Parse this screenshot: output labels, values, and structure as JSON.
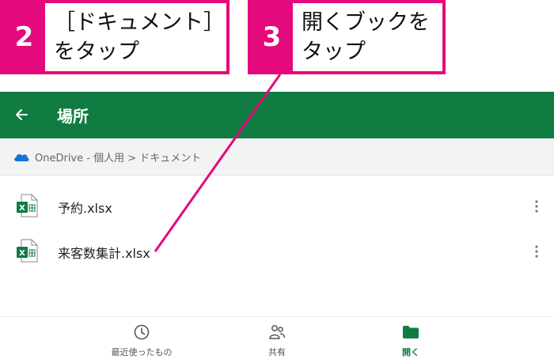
{
  "callouts": [
    {
      "number": "2",
      "text": "［ドキュメント］\nをタップ"
    },
    {
      "number": "3",
      "text": "開くブックを\nタップ"
    }
  ],
  "appbar": {
    "title": "場所"
  },
  "breadcrumb": {
    "path": "OneDrive - 個人用 > ドキュメント"
  },
  "files": [
    {
      "name": "予約.xlsx"
    },
    {
      "name": "来客数集計.xlsx"
    }
  ],
  "bottom_nav": {
    "recent": "最近使ったもの",
    "shared": "共有",
    "open": "開く",
    "active": "open"
  },
  "colors": {
    "excel_green": "#107c41",
    "accent_pink": "#e4097c",
    "onedrive_blue": "#0f78d4"
  },
  "icons": [
    "back-arrow-icon",
    "onedrive-cloud-icon",
    "excel-file-icon",
    "more-vertical-icon",
    "clock-icon",
    "people-icon",
    "folder-icon"
  ]
}
